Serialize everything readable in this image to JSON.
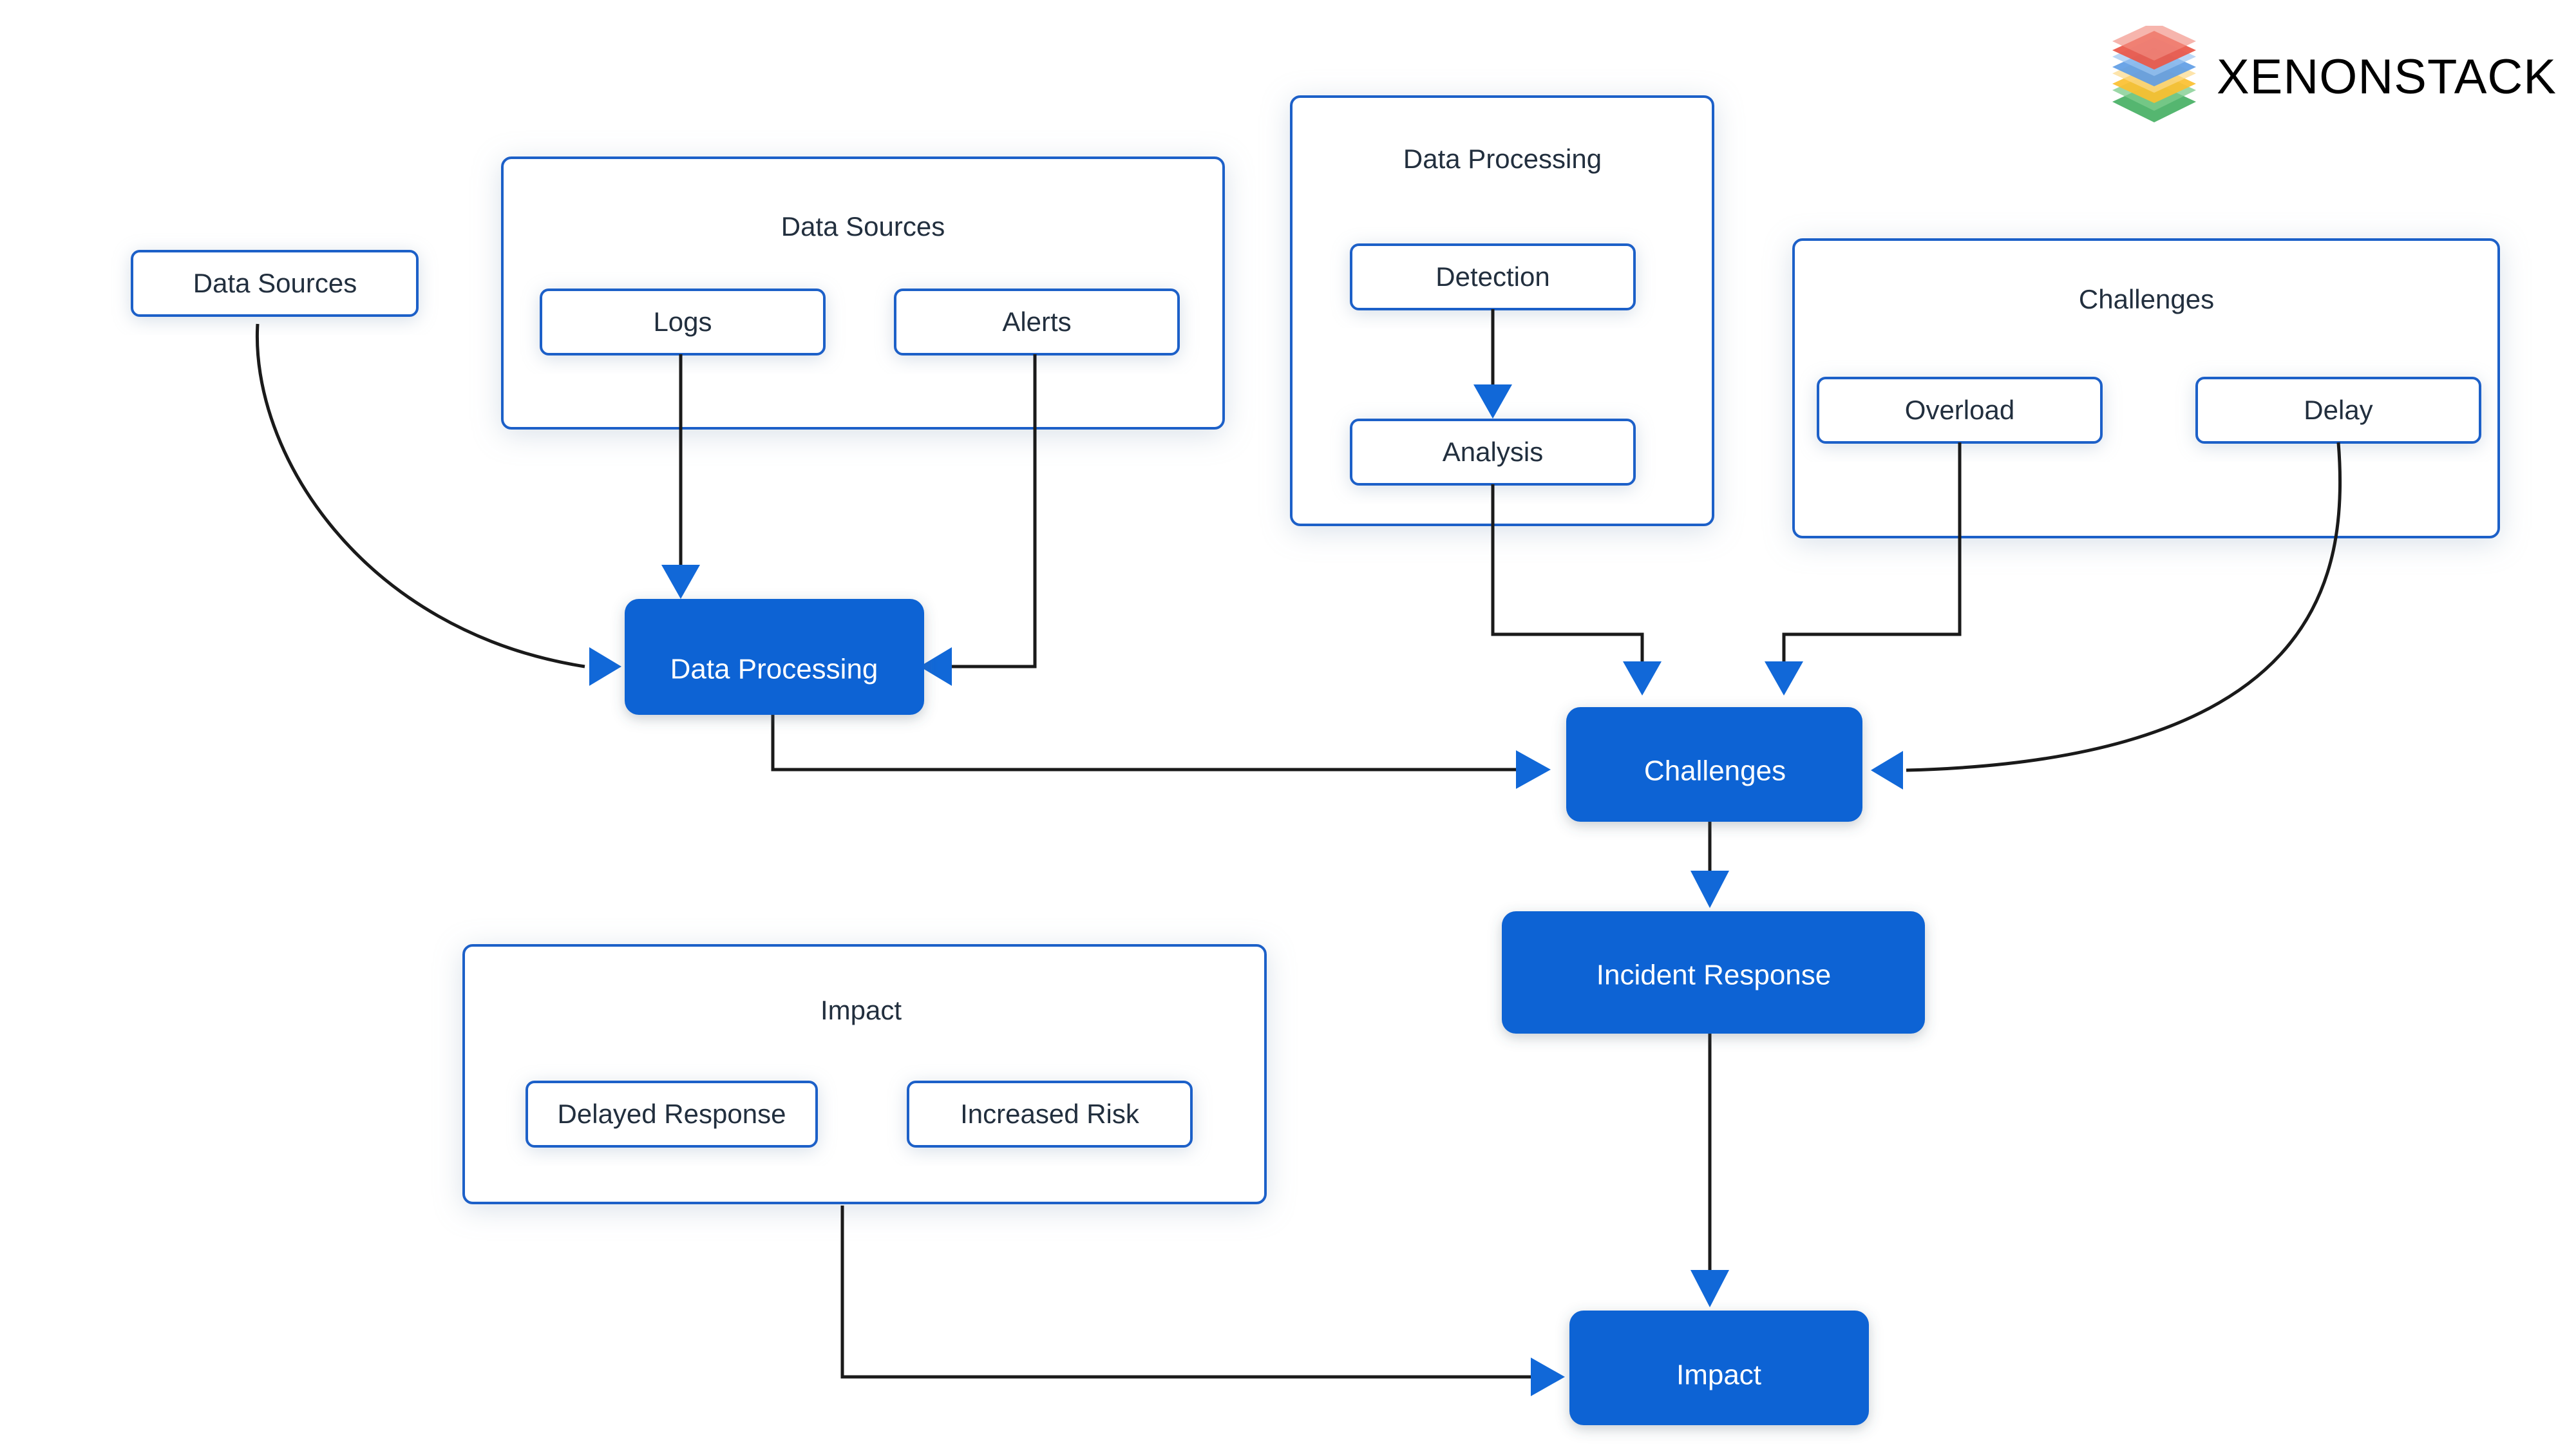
{
  "brand": {
    "name": "XENONSTACK",
    "logo_icon": "xenonstack-stack-logo-icon",
    "logo_layer_colors": [
      "#e8412f",
      "#4a90e2",
      "#fbb713",
      "#34a853"
    ]
  },
  "colors": {
    "accent_blue": "#0a63d4",
    "border_blue": "#1f60c8",
    "arrow_blue": "#1168d8",
    "edge_black": "#1a1a1a",
    "text_dark": "#222f3e",
    "text_on_accent": "#ffffff",
    "canvas": "#ffffff"
  },
  "groups": [
    {
      "id": "group-data-sources",
      "label": "Data Sources",
      "children": [
        {
          "id": "node-logs",
          "label": "Logs"
        },
        {
          "id": "node-alerts",
          "label": "Alerts"
        }
      ]
    },
    {
      "id": "group-data-processing",
      "label": "Data Processing",
      "children": [
        {
          "id": "node-detection",
          "label": "Detection"
        },
        {
          "id": "node-analysis",
          "label": "Analysis"
        }
      ]
    },
    {
      "id": "group-challenges",
      "label": "Challenges",
      "children": [
        {
          "id": "node-overload",
          "label": "Overload"
        },
        {
          "id": "node-delay",
          "label": "Delay"
        }
      ]
    },
    {
      "id": "group-impact",
      "label": "Impact",
      "children": [
        {
          "id": "node-delayed-response",
          "label": "Delayed Response"
        },
        {
          "id": "node-increased-risk",
          "label": "Increased Risk"
        }
      ]
    }
  ],
  "standalone_nodes": [
    {
      "id": "node-data-sources-outline",
      "label": "Data Sources",
      "style": "outline"
    }
  ],
  "primary_nodes": [
    {
      "id": "node-data-processing-solid",
      "label": "Data Processing",
      "style": "solid"
    },
    {
      "id": "node-challenges-solid",
      "label": "Challenges",
      "style": "solid"
    },
    {
      "id": "node-incident-response",
      "label": "Incident Response",
      "style": "solid"
    },
    {
      "id": "node-impact-solid",
      "label": "Impact",
      "style": "solid"
    }
  ],
  "edges": [
    {
      "from": "Data Sources",
      "to": "Data Processing",
      "shape": "curve"
    },
    {
      "from": "Logs",
      "to": "Data Processing",
      "shape": "straight"
    },
    {
      "from": "Alerts",
      "to": "Data Processing",
      "shape": "orthogonal"
    },
    {
      "from": "Detection",
      "to": "Analysis",
      "shape": "straight"
    },
    {
      "from": "Analysis",
      "to": "Challenges",
      "shape": "orthogonal"
    },
    {
      "from": "Overload",
      "to": "Challenges",
      "shape": "orthogonal"
    },
    {
      "from": "Delay",
      "to": "Challenges",
      "shape": "curve"
    },
    {
      "from": "Data Processing",
      "to": "Challenges",
      "shape": "orthogonal"
    },
    {
      "from": "Challenges",
      "to": "Incident Response",
      "shape": "straight"
    },
    {
      "from": "Incident Response",
      "to": "Impact",
      "shape": "straight"
    },
    {
      "from": "Impact group",
      "to": "Impact",
      "shape": "orthogonal"
    }
  ]
}
